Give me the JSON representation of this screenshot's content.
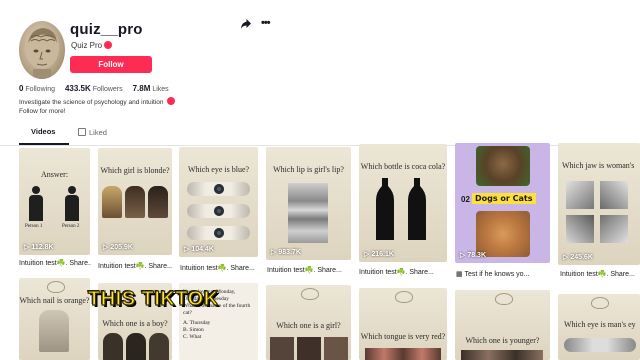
{
  "profile": {
    "username": "quiz__pro",
    "display_name": "Quiz Pro",
    "follow_label": "Follow",
    "stats": [
      {
        "value": "0",
        "label": "Following"
      },
      {
        "value": "433.5K",
        "label": "Followers"
      },
      {
        "value": "7.8M",
        "label": "Likes"
      }
    ],
    "bio_line1": "Investigate the science of psychology and intuition",
    "bio_line2": "Follow for more!"
  },
  "icons": {
    "share": "share-icon",
    "more": "more-icon",
    "play": "play-icon",
    "lock": "lock-icon"
  },
  "colors": {
    "accent": "#fe2c55",
    "overlay_text": "#ffe73c"
  },
  "tabs": [
    {
      "label": "Videos",
      "active": true
    },
    {
      "label": "Liked",
      "active": false
    }
  ],
  "videos_row1": [
    {
      "title": "Answer:",
      "views": "112.8K",
      "caption": "Intuition test☘️. Share..."
    },
    {
      "title": "Which girl is blonde?",
      "views": "205.9K",
      "caption": "Intuition test☘️. Share..."
    },
    {
      "title": "Which eye is blue?",
      "views": "104.4K",
      "caption": "Intuition test☘️. Share..."
    },
    {
      "title": "Which lip is girl's lip?",
      "views": "983.7K",
      "caption": "Intuition test☘️. Share..."
    },
    {
      "title": "Which bottle is coca cola?",
      "views": "216.1K",
      "caption": "Intuition test☘️. Share..."
    },
    {
      "title": "Dogs or Cats",
      "views": "78.3K",
      "caption": "Test if he knows yo..."
    },
    {
      "title": "Which jaw is woman's",
      "views": "245.6K",
      "caption": "Intuition test☘️. Share..."
    }
  ],
  "card_details": {
    "answer_labels": [
      "Person 1",
      "Person 2"
    ],
    "dogs_cats_number": "02"
  },
  "videos_row2": [
    {
      "title": "Which nail is orange?"
    },
    {
      "title": "Which one is a boy?"
    },
    {
      "title": "Which one is a girl?"
    },
    {
      "title": "Which tongue is very red?"
    },
    {
      "title": "Which one is younger?"
    },
    {
      "title": "Which eye is man's ey"
    }
  ],
  "quiz_text": {
    "line1": "Yesterday was Monday,",
    "line2": "Tuesday, Wednesday",
    "question": "What is the name of the fourth cat?",
    "options": [
      "A. Thursday",
      "B. Simon",
      "C. What"
    ]
  },
  "overlay_caption": "THIS TIKTOK"
}
